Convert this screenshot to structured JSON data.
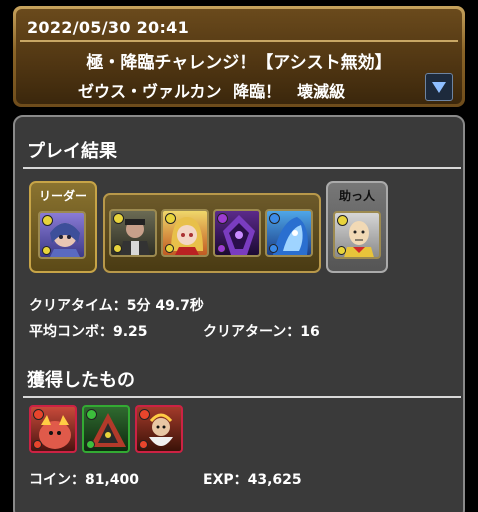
{
  "header": {
    "datetime": "2022/05/30 20:41",
    "title": "極・降臨チャレンジ！【アシスト無効】",
    "subtitle": "ゼウス・ヴァルカン 降臨！　壊滅級"
  },
  "results": {
    "section_title": "プレイ結果",
    "leader_label": "リーダー",
    "helper_label": "助っ人",
    "clear_time": "クリアタイム：5分 49.7秒",
    "avg_combo": "平均コンボ：9.25",
    "clear_turns": "クリアターン：16"
  },
  "rewards": {
    "section_title": "獲得したもの",
    "coins": "コイン：81,400",
    "exp": "EXP：43,625"
  },
  "icons": {
    "dropdown": "triangle-down-icon"
  },
  "colors": {
    "header_gold": "#c7a35d",
    "panel_bg": "#3a3a3a",
    "dropdown_arrow": "#8fbfff"
  }
}
